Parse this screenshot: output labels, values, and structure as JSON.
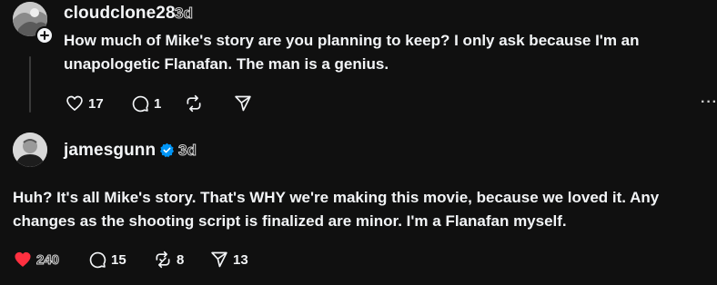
{
  "posts": [
    {
      "username": "cloudclone28",
      "time": "3d",
      "text_lines": [
        "How much of Mike's story are you planning to keep? I only ask because I'm an",
        "unapologetic Flanafan. The man is a genius."
      ],
      "likes": "17",
      "replies": "1",
      "reposts": "",
      "shares": ""
    },
    {
      "username": "jamesgunn",
      "verified": true,
      "time": "3d",
      "text_lines": [
        "Huh? It's all Mike's story. That's WHY we're making this movie, because we loved it. Any",
        "changes as the shooting script is finalized are minor. I'm a Flanafan myself."
      ],
      "likes": "240",
      "replies": "15",
      "reposts": "8",
      "shares": "13"
    }
  ],
  "colors": {
    "background": "#101010",
    "text": "#f3f5f7",
    "like_active": "#ff3040",
    "verified": "#0095f6"
  },
  "icons": [
    "avatar",
    "plus-icon",
    "heart-icon",
    "heart-filled-icon",
    "comment-icon",
    "repost-icon",
    "share-icon",
    "verified-icon",
    "more-icon"
  ],
  "more_label": "···"
}
